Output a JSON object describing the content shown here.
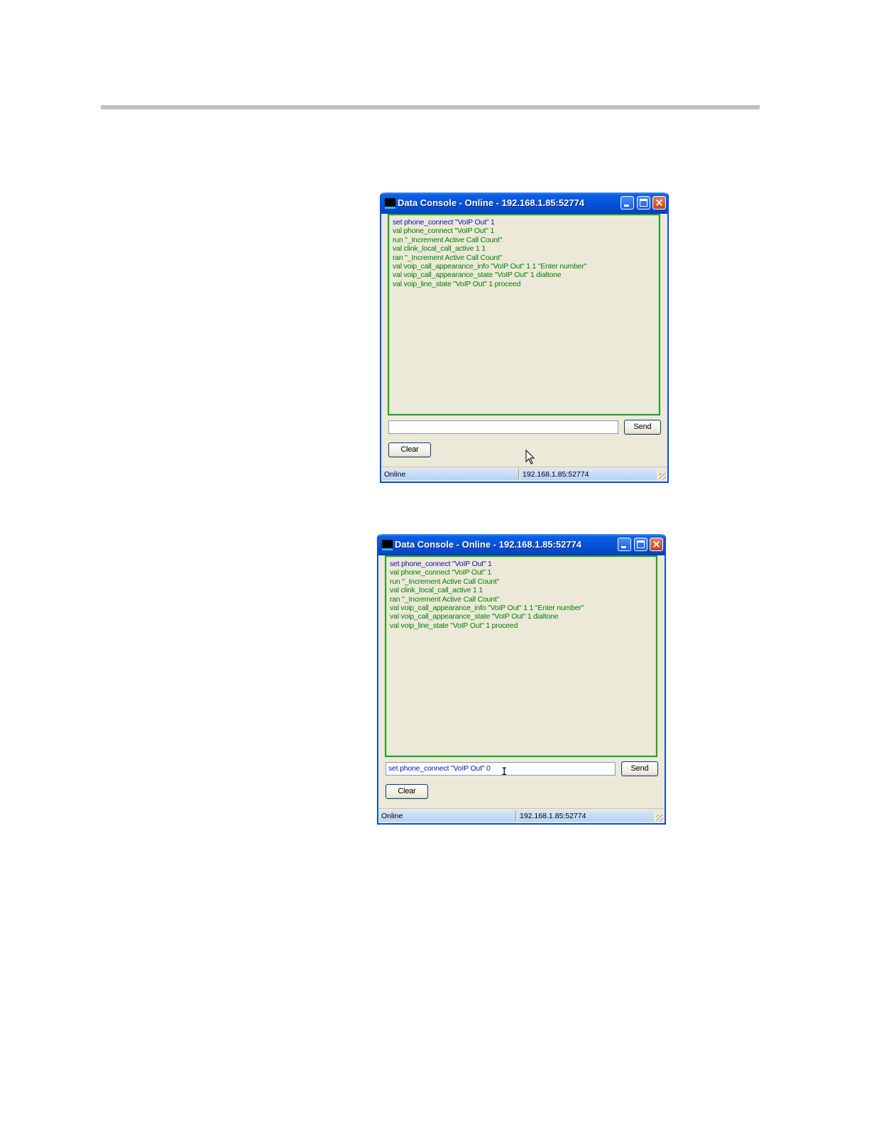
{
  "windows": [
    {
      "title": "Data Console - Online - 192.168.1.85:52774",
      "log_lines": [
        {
          "text": "set phone_connect \"VoIP Out\" 1",
          "kind": "sent"
        },
        {
          "text": "val phone_connect \"VoIP Out\" 1",
          "kind": "recv"
        },
        {
          "text": "run \"_Increment Active Call Count\"",
          "kind": "recv"
        },
        {
          "text": "val clink_local_call_active 1 1",
          "kind": "recv"
        },
        {
          "text": "ran \"_Increment Active Call Count\"",
          "kind": "recv"
        },
        {
          "text": "val voip_call_appearance_info \"VoIP Out\" 1 1 \"Enter number\"",
          "kind": "recv"
        },
        {
          "text": "val voip_call_appearance_state \"VoIP Out\" 1 dialtone",
          "kind": "recv"
        },
        {
          "text": "val voip_line_state \"VoIP Out\" 1 proceed",
          "kind": "recv"
        }
      ],
      "command_value": "",
      "send_label": "Send",
      "clear_label": "Clear",
      "status_state": "Online",
      "status_address": "192.168.1.85:52774"
    },
    {
      "title": "Data Console - Online - 192.168.1.85:52774",
      "log_lines": [
        {
          "text": "set phone_connect \"VoIP Out\" 1",
          "kind": "sent"
        },
        {
          "text": "val phone_connect \"VoIP Out\" 1",
          "kind": "recv"
        },
        {
          "text": "run \"_Increment Active Call Count\"",
          "kind": "recv"
        },
        {
          "text": "val clink_local_call_active 1 1",
          "kind": "recv"
        },
        {
          "text": "ran \"_Increment Active Call Count\"",
          "kind": "recv"
        },
        {
          "text": "val voip_call_appearance_info \"VoIP Out\" 1 1 \"Enter number\"",
          "kind": "recv"
        },
        {
          "text": "val voip_call_appearance_state \"VoIP Out\" 1 dialtone",
          "kind": "recv"
        },
        {
          "text": "val voip_line_state \"VoIP Out\" 1 proceed",
          "kind": "recv"
        }
      ],
      "command_value": "set phone_connect \"VoIP Out\" 0",
      "send_label": "Send",
      "clear_label": "Clear",
      "status_state": "Online",
      "status_address": "192.168.1.85:52774"
    }
  ],
  "colors": {
    "sent_text": "#1010b0",
    "received_text": "#008000",
    "titlebar": "#0553d8",
    "window_body": "#ece9d8"
  }
}
